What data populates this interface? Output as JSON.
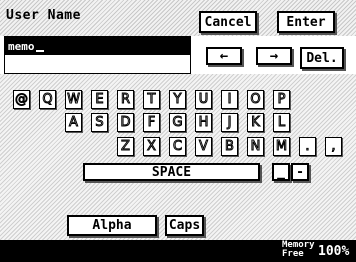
{
  "header": {
    "title": "User Name",
    "cancel_label": "Cancel",
    "enter_label": "Enter"
  },
  "input": {
    "value": "memo"
  },
  "edit": {
    "left_arrow": "←",
    "right_arrow": "→",
    "delete_label": "Del."
  },
  "keyboard": {
    "row1": [
      "@",
      "Q",
      "W",
      "E",
      "R",
      "T",
      "Y",
      "U",
      "I",
      "O",
      "P"
    ],
    "row2": [
      "A",
      "S",
      "D",
      "F",
      "G",
      "H",
      "J",
      "K",
      "L"
    ],
    "row3": [
      "Z",
      "X",
      "C",
      "V",
      "B",
      "N",
      "M",
      ".",
      ","
    ],
    "space_label": "SPACE",
    "underscore_label": "_",
    "hyphen_label": "-"
  },
  "mode": {
    "alpha_label": "Alpha",
    "caps_label": "Caps"
  },
  "footer": {
    "memory_line1": "Memory",
    "memory_line2": "Free",
    "memory_value": "100%"
  }
}
